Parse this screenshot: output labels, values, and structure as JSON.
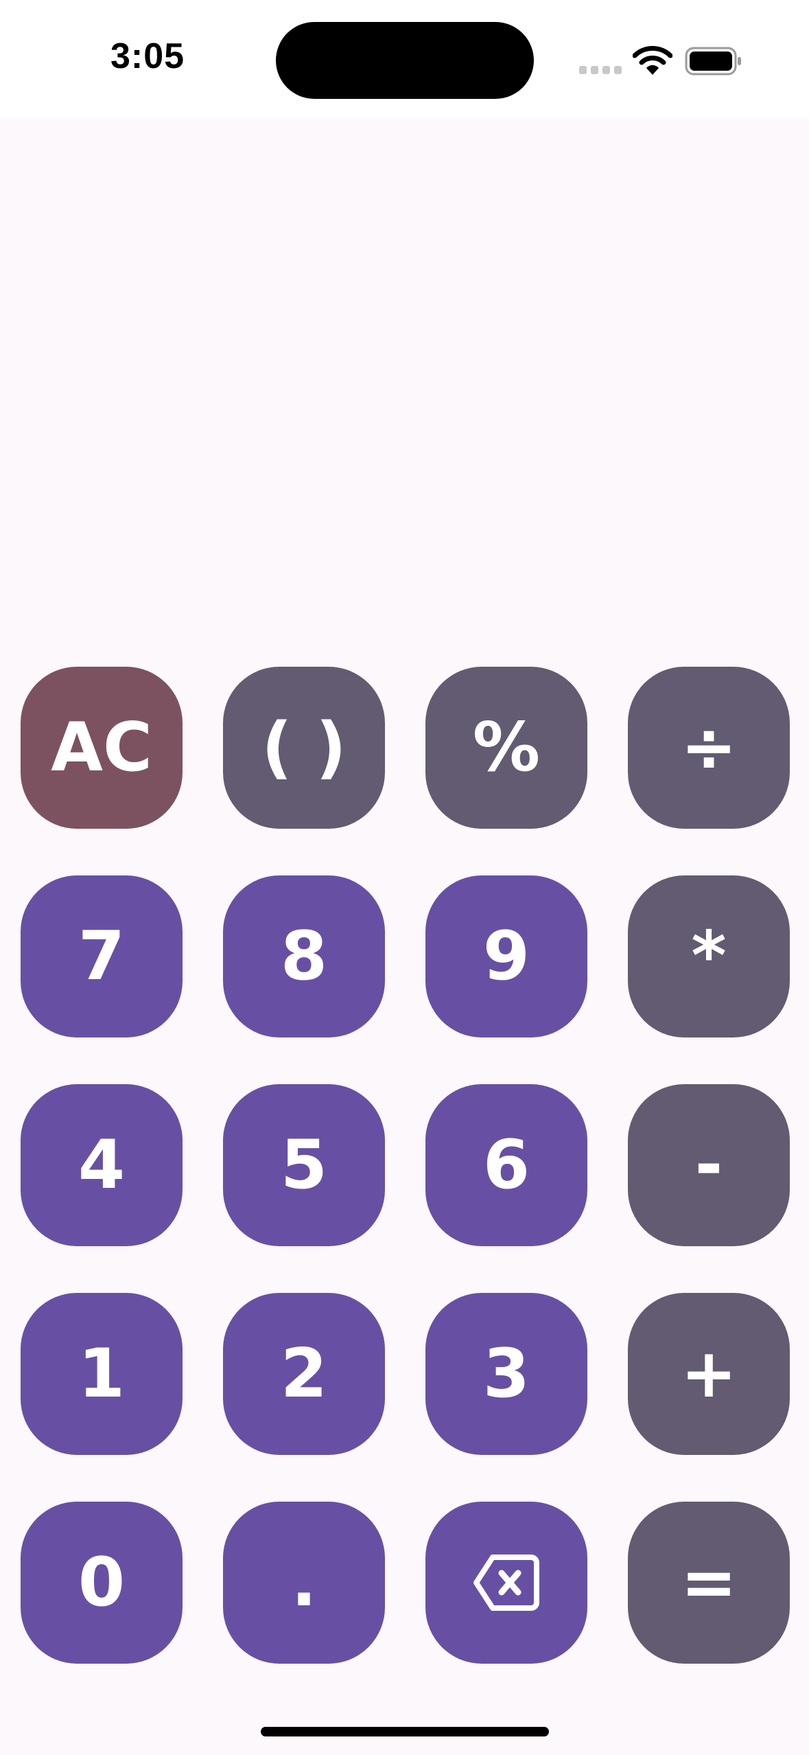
{
  "status_bar": {
    "time": "3:05",
    "icons": [
      "cellular-signal-icon",
      "wifi-icon",
      "battery-icon"
    ]
  },
  "display": {
    "expression": ""
  },
  "keypad": {
    "rows": [
      [
        {
          "label": "AC",
          "kind": "clear"
        },
        {
          "label": "( )",
          "kind": "function"
        },
        {
          "label": "%",
          "kind": "function"
        },
        {
          "label": "÷",
          "kind": "function"
        }
      ],
      [
        {
          "label": "7",
          "kind": "number"
        },
        {
          "label": "8",
          "kind": "number"
        },
        {
          "label": "9",
          "kind": "number"
        },
        {
          "label": "*",
          "kind": "function"
        }
      ],
      [
        {
          "label": "4",
          "kind": "number"
        },
        {
          "label": "5",
          "kind": "number"
        },
        {
          "label": "6",
          "kind": "number"
        },
        {
          "label": "-",
          "kind": "function"
        }
      ],
      [
        {
          "label": "1",
          "kind": "number"
        },
        {
          "label": "2",
          "kind": "number"
        },
        {
          "label": "3",
          "kind": "number"
        },
        {
          "label": "+",
          "kind": "function"
        }
      ],
      [
        {
          "label": "0",
          "kind": "number"
        },
        {
          "label": ".",
          "kind": "number"
        },
        {
          "label": "",
          "kind": "number",
          "icon": "backspace-icon"
        },
        {
          "label": "=",
          "kind": "function"
        }
      ]
    ]
  },
  "colors": {
    "background": "#fdf8fc",
    "clear_key": "#7d5260",
    "function_key": "#625b71",
    "number_key": "#6750a4",
    "key_text": "#ffffff"
  }
}
